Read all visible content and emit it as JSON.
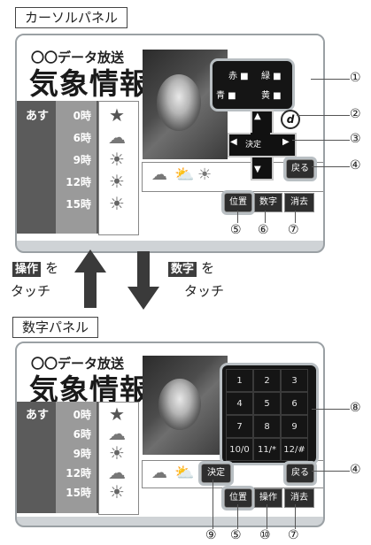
{
  "top_panel": {
    "title": "カーソルパネル",
    "news": "〇〇データ放送",
    "heading": "気象情報",
    "day_label": "あす",
    "times": [
      "0時",
      "6時",
      "9時",
      "12時",
      "15時"
    ],
    "weather_icons": [
      "star-icon",
      "cloud-icon",
      "sun-icon",
      "sun-icon",
      "sun-icon"
    ],
    "color_keys": {
      "red": "赤",
      "green": "緑",
      "blue": "青",
      "yellow": "黄"
    },
    "buttons": {
      "d": "d",
      "enter": "決定",
      "back": "戻る",
      "position": "位置",
      "number": "数字",
      "clear": "消去"
    },
    "dpad": {
      "up": "▲",
      "down": "▼",
      "left": "◀",
      "right": "▶"
    }
  },
  "middle": {
    "left_tag": "操作",
    "left_suffix": "を",
    "left_touch": "タッチ",
    "right_tag": "数字",
    "right_suffix": "を",
    "right_touch": "タッチ"
  },
  "bottom_panel": {
    "title": "数字パネル",
    "news": "〇〇データ放送",
    "heading": "気象情報",
    "day_label": "あす",
    "times": [
      "0時",
      "6時",
      "9時",
      "12時",
      "15時"
    ],
    "numpad": [
      "1",
      "2",
      "3",
      "4",
      "5",
      "6",
      "7",
      "8",
      "9",
      "10/0",
      "11/*",
      "12/#"
    ],
    "buttons": {
      "enter": "決定",
      "back": "戻る",
      "position": "位置",
      "operation": "操作",
      "clear": "消去"
    }
  },
  "callouts": {
    "c1": "①",
    "c2": "②",
    "c3": "③",
    "c4": "④",
    "c5": "⑤",
    "c6": "⑥",
    "c7": "⑦",
    "c8": "⑧",
    "c9": "⑨",
    "c10": "⑩",
    "c4b": "④",
    "c5b": "⑤",
    "c7b": "⑦"
  }
}
